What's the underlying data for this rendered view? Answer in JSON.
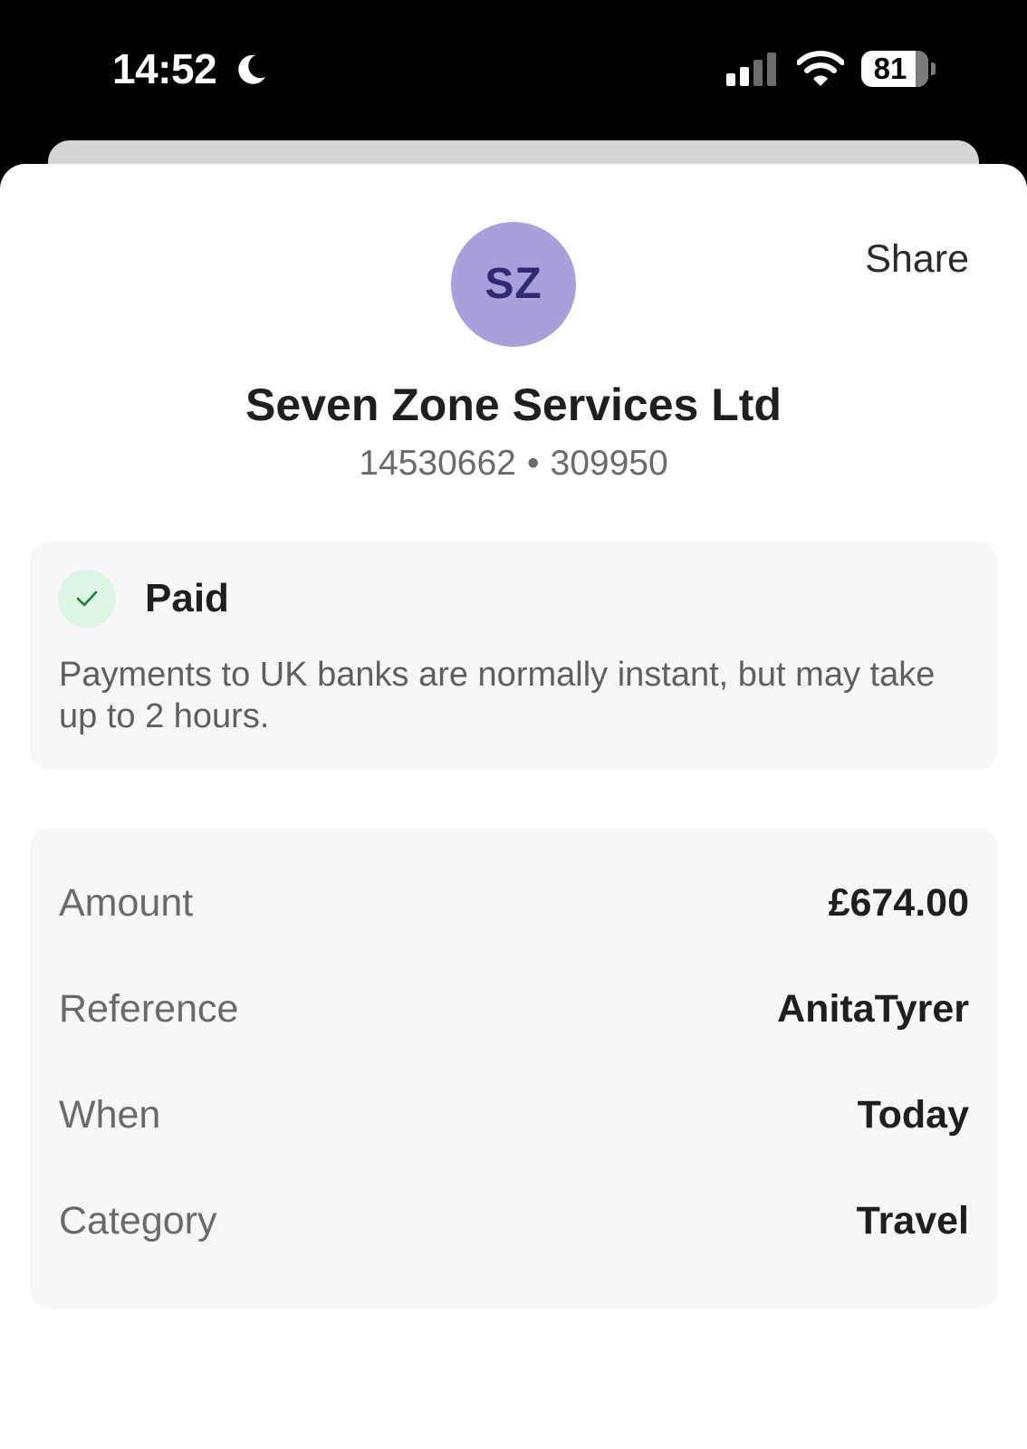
{
  "status_bar": {
    "time": "14:52",
    "battery_level": "81",
    "battery_fraction": 0.81,
    "icons": [
      "moon-icon",
      "signal-icon",
      "wifi-icon",
      "battery-icon"
    ]
  },
  "header": {
    "share_label": "Share",
    "avatar_initials": "SZ",
    "payee_name": "Seven Zone Services Ltd",
    "account_number": "14530662",
    "separator": "•",
    "sort_code": "309950"
  },
  "status": {
    "label": "Paid",
    "icon": "check-icon",
    "description": "Payments to UK banks are normally instant, but may take up to 2 hours."
  },
  "details": {
    "rows": [
      {
        "label": "Amount",
        "value": "£674.00"
      },
      {
        "label": "Reference",
        "value": "AnitaTyrer"
      },
      {
        "label": "When",
        "value": "Today"
      },
      {
        "label": "Category",
        "value": "Travel"
      }
    ]
  },
  "colors": {
    "avatar_bg": "#a99fdb",
    "avatar_text": "#2f2a73",
    "check_bg": "#dcf6e4",
    "check_mark": "#1f7a3e",
    "card_bg": "#f7f7f7"
  }
}
